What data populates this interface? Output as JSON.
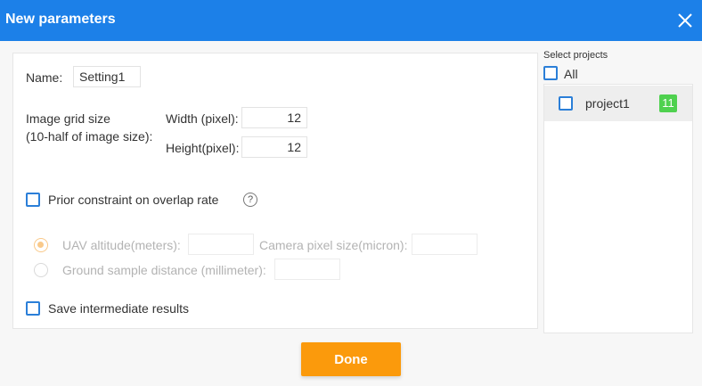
{
  "window": {
    "title": "New parameters"
  },
  "form": {
    "name_label": "Name:",
    "name_value": "Setting1",
    "grid_label_line1": "Image grid size",
    "grid_label_line2": "(10-half of image size):",
    "width_label": "Width (pixel):",
    "width_value": "12",
    "height_label": "Height(pixel):",
    "height_value": "12",
    "prior_constraint_label": "Prior constraint on overlap rate",
    "prior_constraint_checked": false,
    "help_glyph": "?",
    "uav_altitude_label": "UAV altitude(meters):",
    "uav_altitude_value": "",
    "uav_altitude_selected": true,
    "camera_pixel_label": "Camera pixel size(micron):",
    "camera_pixel_value": "",
    "gsd_label": "Ground sample distance (millimeter):",
    "gsd_value": "",
    "gsd_selected": false,
    "save_intermediate_label": "Save intermediate results",
    "save_intermediate_checked": false
  },
  "projects": {
    "header": "Select projects",
    "all_label": "All",
    "items": [
      {
        "name": "project1",
        "count": "11",
        "checked": false
      }
    ]
  },
  "actions": {
    "done_label": "Done"
  },
  "colors": {
    "titlebar": "#1c80e8",
    "checkbox_border": "#2b7fd8",
    "done_button": "#fb9a0c",
    "badge": "#4fd14f"
  }
}
